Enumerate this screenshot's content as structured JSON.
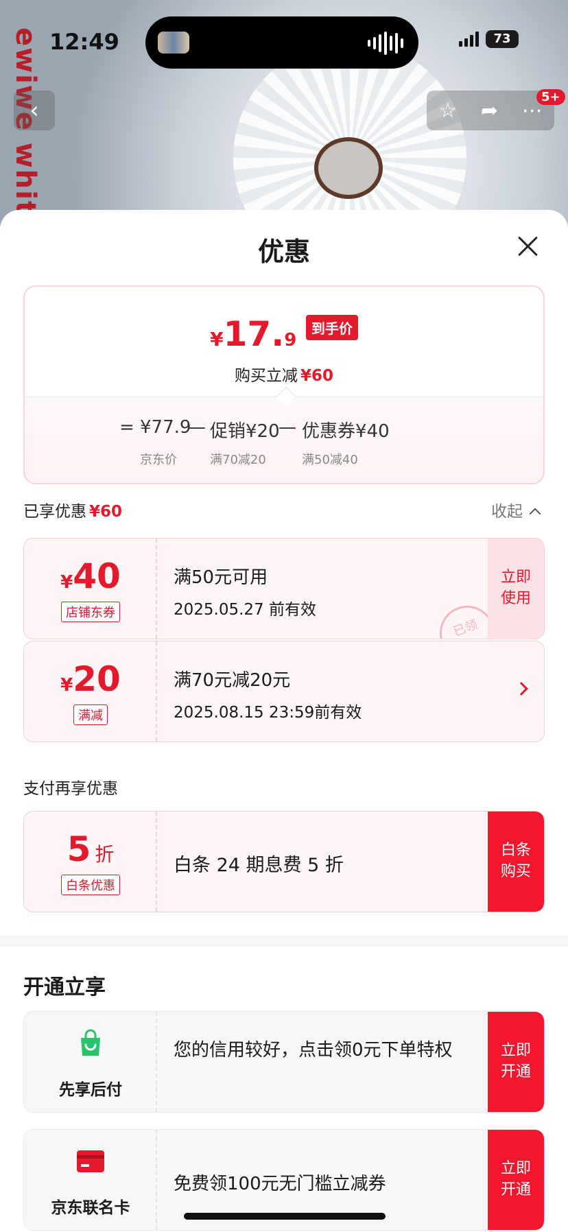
{
  "status_bar": {
    "time": "12:49",
    "battery": "73"
  },
  "brand_text": "ewiwe whit",
  "nav": {
    "badge": "5+"
  },
  "sheet": {
    "title": "优惠",
    "summary": {
      "yen": "¥",
      "price_int": "17.",
      "price_dec": "9",
      "price_tag": "到手价",
      "save_label": "购买立减",
      "save_amount": "¥60",
      "eq": "=",
      "jd_price": "¥77.9",
      "minus": "—",
      "promo": "促销¥20",
      "coupon": "优惠券¥40",
      "jd_price_label": "京东价",
      "promo_rule": "满70减20",
      "coupon_rule": "满50减40"
    },
    "enjoyed": {
      "label": "已享优惠",
      "amount": "¥60",
      "collapse": "收起"
    },
    "coupons": [
      {
        "yen": "¥",
        "amount": "40",
        "chip": "店铺东券",
        "line1": "满50元可用",
        "line2": "2025.05.27 前有效",
        "action": "立即使用",
        "stamp": "已领"
      },
      {
        "yen": "¥",
        "amount": "20",
        "chip": "满减",
        "line1": "满70元减20元",
        "line2": "2025.08.15 23:59前有效"
      }
    ],
    "pay_section": "支付再享优惠",
    "baitiao": {
      "amount": "5",
      "unit": "折",
      "chip": "白条优惠",
      "text": "白条 24 期息费 5 折",
      "action": "白条购买"
    },
    "open_title": "开通立享",
    "features": [
      {
        "label": "先享后付",
        "text": "您的信用较好，点击领0元下单特权",
        "action": "立即开通",
        "icon": "shopping-bag-icon",
        "icon_color": "#27c46b"
      },
      {
        "label": "京东联名卡",
        "text": "免费领100元无门槛立减券",
        "action": "立即开通",
        "icon": "credit-card-icon",
        "icon_color": "#e3192c"
      }
    ]
  },
  "colors": {
    "accent": "#e3192c",
    "action_bg": "#f2172f"
  }
}
